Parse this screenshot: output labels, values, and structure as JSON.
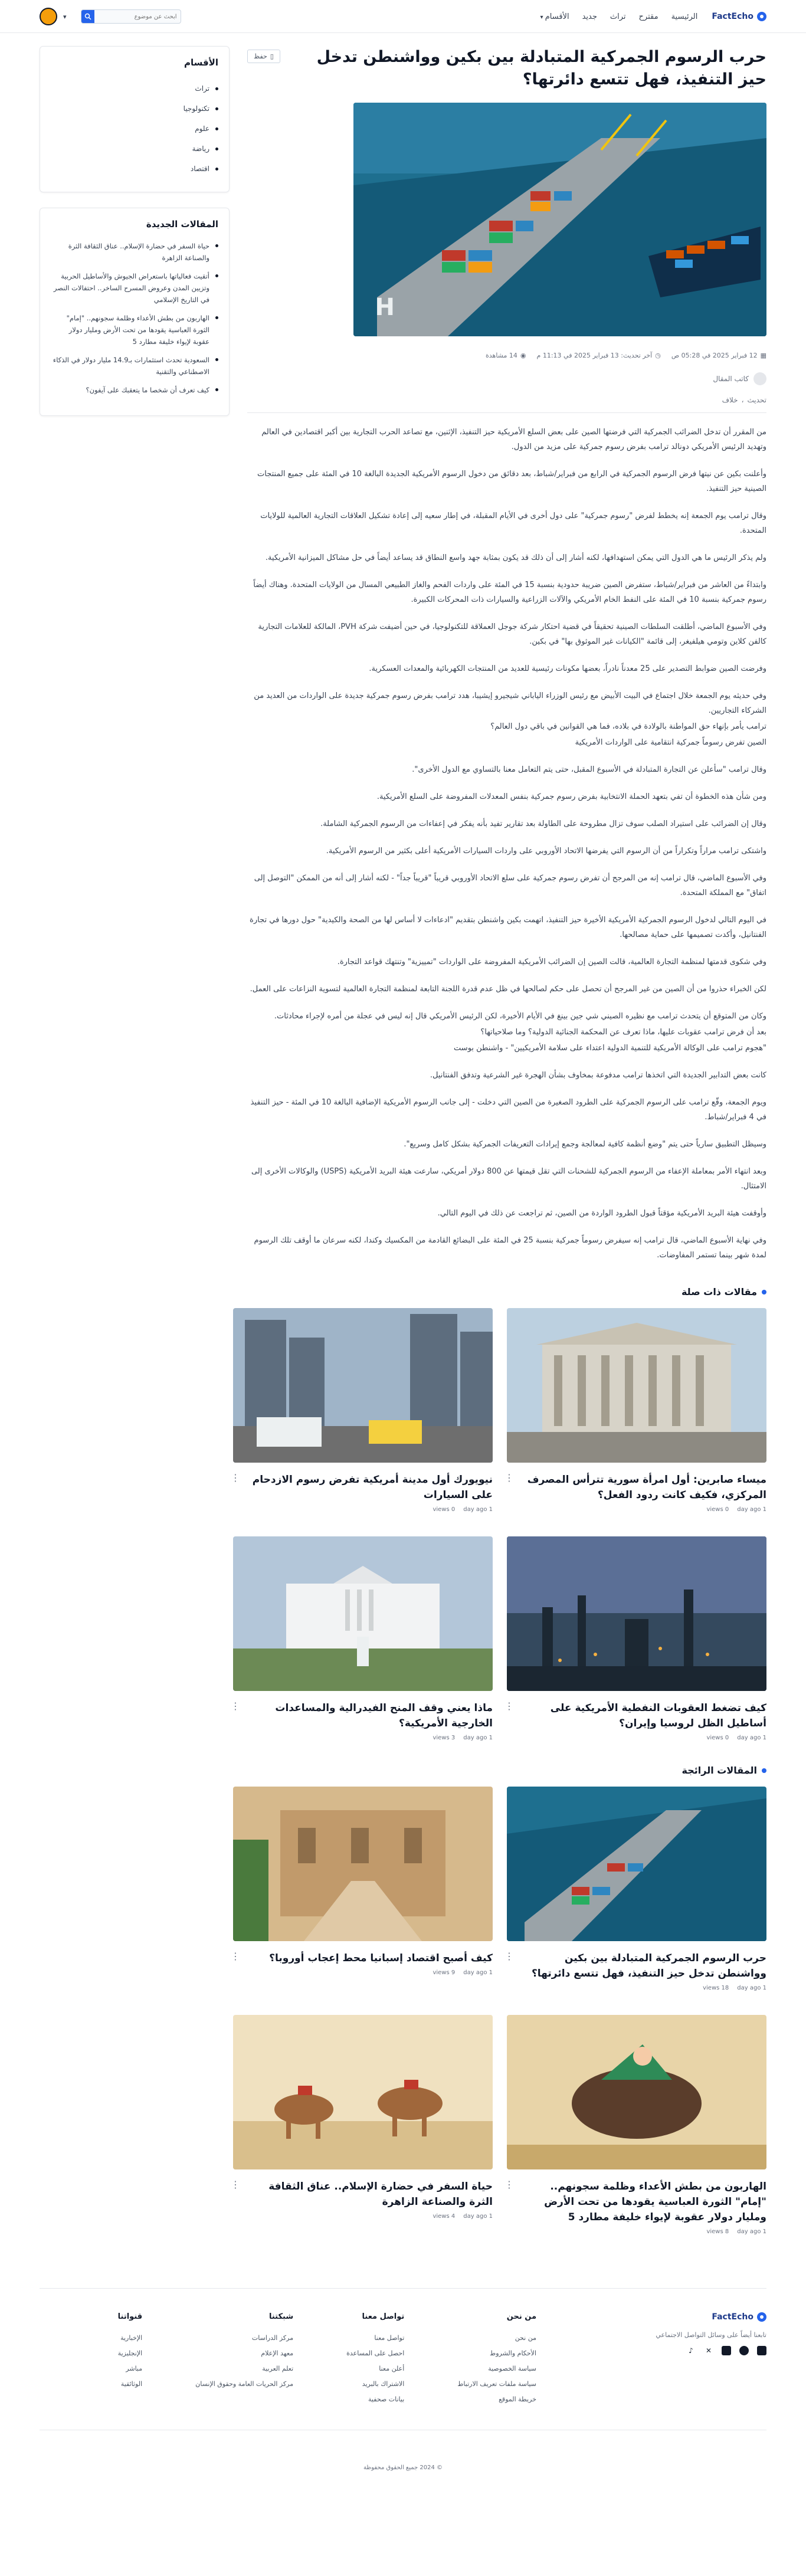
{
  "header": {
    "logo": "FactEcho",
    "nav": [
      "الرئيسية",
      "مقترح",
      "تراث",
      "جديد",
      "الأقسام"
    ],
    "search_placeholder": "ابحث عن موضوع"
  },
  "article": {
    "title": "حرب الرسوم الجمركية المتبادلة بين بكين وواشنطن تدخل حيز التنفيذ، فهل تتسع دائرتها؟",
    "save_label": "حفظ",
    "meta": {
      "published": "12 فبراير 2025 في 05:28 ص",
      "updated": "آخر تحديث: 13 فبراير 2025 في 11:13 م",
      "views": "14 مشاهدة"
    },
    "author_label": "كاتب المقال",
    "tags": [
      "تحديث",
      "خلاف"
    ],
    "paragraphs": [
      "من المقرر أن تدخل الضرائب الجمركية التي فرضتها الصين على بعض السلع الأمريكية حيز التنفيذ، الإثنين، مع تصاعد الحرب التجارية بين أكبر اقتصادين في العالم وتهديد الرئيس الأمريكي دونالد ترامب بفرض رسوم جمركية على مزيد من الدول.",
      "وأعلنت بكين عن نيتها فرض الرسوم الجمركية في الرابع من فبراير/شباط، بعد دقائق من دخول الرسوم الأمريكية الجديدة البالغة 10 في المئة على جميع المنتجات الصينية حيز التنفيذ.",
      "وقال ترامب يوم الجمعة إنه يخطط لفرض \"رسوم جمركية\" على دول أخرى في الأيام المقبلة، في إطار سعيه إلى إعادة تشكيل العلاقات التجارية العالمية للولايات المتحدة.",
      "ولم يذكر الرئيس ما هي الدول التي يمكن استهدافها، لكنه أشار إلى أن ذلك قد يكون بمثابة جهد واسع النطاق قد يساعد أيضاً في حل مشاكل الميزانية الأمريكية.",
      "وابتداءً من العاشر من فبراير/شباط، ستفرض الصين ضريبة حدودية بنسبة 15 في المئة على واردات الفحم والغاز الطبيعي المسال من الولايات المتحدة. وهناك أيضاً رسوم جمركية بنسبة 10 في المئة على النفط الخام الأمريكي والآلات الزراعية والسيارات ذات المحركات الكبيرة.",
      "وفي الأسبوع الماضي، أطلقت السلطات الصينية تحقيقاً في قضية احتكار شركة جوجل العملاقة للتكنولوجيا، في حين أضيفت شركة PVH، المالكة للعلامات التجارية كالفن كلاين وتومي هيلفيغر، إلى قائمة \"الكيانات غير الموثوق بها\" في بكين.",
      "وفرضت الصين ضوابط التصدير على 25 معدناً نادراً، بعضها مكونات رئيسية للعديد من المنتجات الكهربائية والمعدات العسكرية.",
      "وفي حديثه يوم الجمعة خلال اجتماع في البيت الأبيض مع رئيس الوزراء الياباني شيجيرو إيشيبا، هدد ترامب بفرض رسوم جمركية جديدة على الواردات من العديد من الشركاء التجاريين.",
      "ترامب يأمر بإنهاء حق المواطنة بالولادة في بلاده، فما هي القوانين في باقي دول العالم؟",
      "الصين تفرض رسوماً جمركية انتقامية على الواردات الأمريكية",
      "وقال ترامب \"سأعلن عن التجارة المتبادلة في الأسبوع المقبل، حتى يتم التعامل معنا بالتساوي مع الدول الأخرى\".",
      "ومن شأن هذه الخطوة أن تفي بتعهد الحملة الانتخابية بفرض رسوم جمركية بنفس المعدلات المفروضة على السلع الأمريكية.",
      "وقال إن الضرائب على استيراد الصلب سوف تزال مطروحة على الطاولة بعد تقارير تفيد بأنه يفكر في إعفاءات من الرسوم الجمركية الشاملة.",
      "واشتكى ترامب مراراً وتكراراً من أن الرسوم التي يفرضها الاتحاد الأوروبي على واردات السيارات الأمريكية أعلى بكثير من الرسوم الأمريكية.",
      "وفي الأسبوع الماضي، قال ترامب إنه من المرجح أن تفرض رسوم جمركية على سلع الاتحاد الأوروبي قريباً \"قريباً جداً\" - لكنه أشار إلى أنه من الممكن \"التوصل إلى اتفاق\" مع المملكة المتحدة.",
      "في اليوم التالي لدخول الرسوم الجمركية الأمريكية الأخيرة حيز التنفيذ، اتهمت بكين واشنطن بتقديم \"ادعاءات لا أساس لها من الصحة والكيدية\" حول دورها في تجارة الفنتانيل، وأكدت تصميمها على حماية مصالحها.",
      "وفي شكوى قدمتها لمنظمة التجارة العالمية، قالت الصين إن الضرائب الأمريكية المفروضة على الواردات \"تمييزية\" وتنتهك قواعد التجارة.",
      "لكن الخبراء حذروا من أن الصين من غير المرجح أن تحصل على حكم لصالحها في ظل عدم قدرة اللجنة التابعة لمنظمة التجارة العالمية لتسوية النزاعات على العمل.",
      "وكان من المتوقع أن يتحدث ترامب مع نظيره الصيني شي جين بينغ في الأيام الأخيرة، لكن الرئيس الأمريكي قال إنه ليس في عجلة من أمره لإجراء محادثات.",
      "بعد أن فرض ترامب عقوبات عليها، ماذا تعرف عن المحكمة الجنائية الدولية؟ وما صلاحياتها؟",
      "\"هجوم ترامب على الوكالة الأمريكية للتنمية الدولية اعتداء على سلامة الأمريكيين\" - واشنطن بوست",
      "كانت بعض التدابير الجديدة التي اتخذها ترامب مدفوعة بمخاوف بشأن الهجرة غير الشرعية وتدفق الفنتانيل.",
      "ويوم الجمعة، وقّع ترامب على الرسوم الجمركية على الطرود الصغيرة من الصين التي دخلت - إلى جانب الرسوم الأمريكية الإضافية البالغة 10 في المئة - حيز التنفيذ في 4 فبراير/شباط.",
      "وسيظل التطبيق سارياً حتى يتم \"وضع أنظمة كافية لمعالجة وجمع إيرادات التعريفات الجمركية بشكل كامل وسريع\".",
      "وبعد انتهاء الأمر بمعاملة الإعفاء من الرسوم الجمركية للشحنات التي تقل قيمتها عن 800 دولار أمريكي، سارعت هيئة البريد الأمريكية (USPS) والوكالات الأخرى إلى الامتثال.",
      "وأوقفت هيئة البريد الأمريكية مؤقتاً قبول الطرود الواردة من الصين، ثم تراجعت عن ذلك في اليوم التالي.",
      "وفي نهاية الأسبوع الماضي، قال ترامب إنه سيفرض رسوماً جمركية بنسبة 25 في المئة على البضائع القادمة من المكسيك وكندا، لكنه سرعان ما أوقف تلك الرسوم لمدة شهر بينما تستمر المفاوضات."
    ]
  },
  "related": {
    "heading": "مقالات ذات صلة",
    "cards": [
      {
        "title": "ميساء صابرين: أول امرأة سورية تترأس المصرف المركزي، فكيف كانت ردود الفعل؟",
        "date": "1 day ago",
        "views": "0 views"
      },
      {
        "title": "نيويورك أول مدينة أمريكية تفرض رسوم الازدحام على السيارات",
        "date": "1 day ago",
        "views": "0 views"
      },
      {
        "title": "كيف تضغط العقوبات النفطية الأمريكية على أساطيل الظل لروسيا وإيران؟",
        "date": "1 day ago",
        "views": "0 views"
      },
      {
        "title": "ماذا يعني وقف المنح الفيدرالية والمساعدات الخارجية الأمريكية؟",
        "date": "1 day ago",
        "views": "3 views"
      }
    ]
  },
  "trending": {
    "heading": "المقالات الرائجة",
    "cards": [
      {
        "title": "حرب الرسوم الجمركية المتبادلة بين بكين وواشنطن تدخل حيز التنفيذ، فهل تتسع دائرتها؟",
        "date": "1 day ago",
        "views": "18 views"
      },
      {
        "title": "كيف أصبح اقتصاد إسبانيا محط إعجاب أوروبا؟",
        "date": "1 day ago",
        "views": "9 views"
      },
      {
        "title": "الهاربون من بطش الأعداء وظلمة سجونهم.. \"إمام\" الثورة العباسية يقودها من تحت الأرض ومليار دولار عقوبة لإيواء خليفة مطارد 5",
        "date": "1 day ago",
        "views": "8 views"
      },
      {
        "title": "حياة السفر في حضارة الإسلام.. عناق الثقافة الثرة والصناعة الزاهرة",
        "date": "1 day ago",
        "views": "4 views"
      }
    ]
  },
  "sidebar": {
    "categories_heading": "الأقسام",
    "categories": [
      "تراث",
      "تكنولوجيا",
      "علوم",
      "رياضة",
      "اقتصاد"
    ],
    "recent_heading": "المقالات الجديدة",
    "recent": [
      "حياة السفر في حضارة الإسلام.. عناق الثقافة الثرة والصناعة الزاهرة",
      "أتقيت فعالياتها باستعراض الجيوش والأساطيل الحربية وتزيين المدن وعروض المسرح الساخر.. احتفالات النصر في التاريخ الإسلامي",
      "الهاربون من بطش الأعداء وظلمة سجونهم.. \"إمام\" الثورة العباسية يقودها من تحت الأرض ومليار دولار عقوبة لإيواء خليفة مطارد 5",
      "السعودية تحدث استثمارات بـ14.9 مليار دولار في الذكاء الاصطناعي والتقنية",
      "كيف تعرف أن شخصا ما يتعقبك على آيفون؟"
    ]
  },
  "footer": {
    "logo": "FactEcho",
    "follow_text": "تابعنا أيضاً على وسائل التواصل الاجتماعي",
    "columns": [
      {
        "title": "من نحن",
        "links": [
          "من نحن",
          "الأحكام والشروط",
          "سياسة الخصوصية",
          "سياسة ملفات تعريف الارتباط",
          "خريطة الموقع"
        ]
      },
      {
        "title": "تواصل معنا",
        "links": [
          "تواصل معنا",
          "احصل على المساعدة",
          "أعلن معنا",
          "الاشتراك بالبريد",
          "بيانات صحفية"
        ]
      },
      {
        "title": "شبكتنا",
        "links": [
          "مركز الدراسات",
          "معهد الإعلام",
          "تعلم العربية",
          "مركز الحريات العامة وحقوق الإنسان"
        ]
      },
      {
        "title": "قنواتنا",
        "links": [
          "الإخبارية",
          "الإنجليزية",
          "مباشر",
          "الوثائقية"
        ]
      }
    ],
    "copyright": "© 2024 جميع الحقوق محفوظة"
  }
}
